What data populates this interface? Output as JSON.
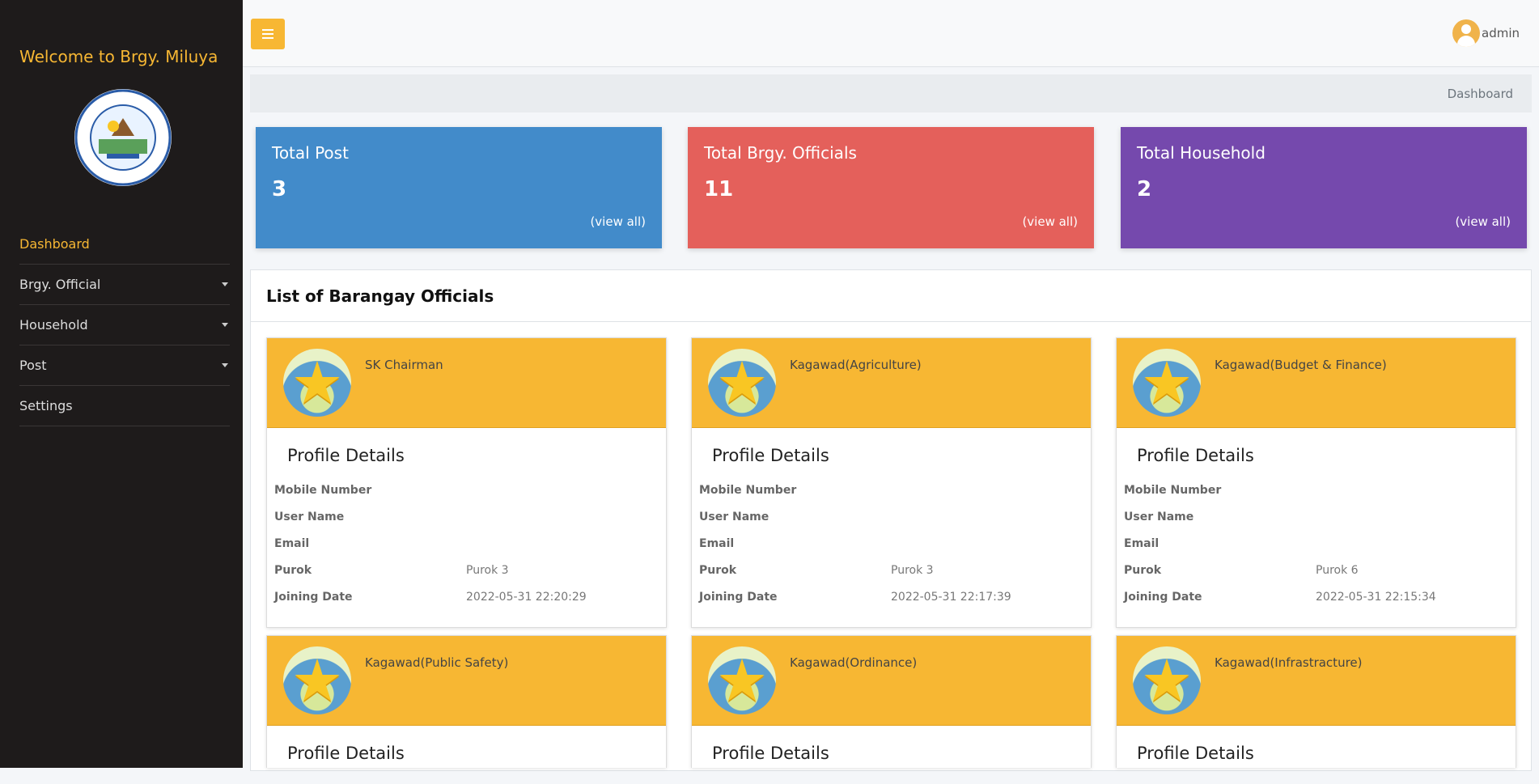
{
  "sidebar": {
    "brand": "Welcome to Brgy. Miluya",
    "logo_text_top": "BARANGAY MILUYA",
    "logo_text_bottom": "CASTILLA, SORSOGON",
    "items": [
      {
        "label": "Dashboard",
        "active": true,
        "has_caret": false
      },
      {
        "label": "Brgy. Official",
        "active": false,
        "has_caret": true
      },
      {
        "label": "Household",
        "active": false,
        "has_caret": true
      },
      {
        "label": "Post",
        "active": false,
        "has_caret": true
      },
      {
        "label": "Settings",
        "active": false,
        "has_caret": false
      }
    ]
  },
  "topbar": {
    "menu_icon": "hamburger-icon",
    "user_name": "admin",
    "user_icon": "user-avatar-icon"
  },
  "breadcrumb": {
    "current": "Dashboard"
  },
  "stats": [
    {
      "title": "Total Post",
      "value": "3",
      "link": "(view all)",
      "color": "#428bca"
    },
    {
      "title": "Total Brgy. Officials",
      "value": "11",
      "link": "(view all)",
      "color": "#e4605b"
    },
    {
      "title": "Total Household",
      "value": "2",
      "link": "(view all)",
      "color": "#7549ad"
    }
  ],
  "officials": {
    "heading": "List of Barangay Officials",
    "section_title": "Profile Details",
    "labels": {
      "mobile": "Mobile Number",
      "username": "User Name",
      "email": "Email",
      "purok": "Purok",
      "joining": "Joining Date"
    },
    "cards": [
      {
        "position": "SK Chairman",
        "mobile": "",
        "username": "",
        "email": "",
        "purok": "Purok 3",
        "joining": "2022-05-31 22:20:29"
      },
      {
        "position": "Kagawad(Agriculture)",
        "mobile": "",
        "username": "",
        "email": "",
        "purok": "Purok 3",
        "joining": "2022-05-31 22:17:39"
      },
      {
        "position": "Kagawad(Budget & Finance)",
        "mobile": "",
        "username": "",
        "email": "",
        "purok": "Purok 6",
        "joining": "2022-05-31 22:15:34"
      },
      {
        "position": "Kagawad(Public Safety)"
      },
      {
        "position": "Kagawad(Ordinance)"
      },
      {
        "position": "Kagawad(Infrastracture)"
      }
    ]
  },
  "colors": {
    "sidebar_bg": "#1e1b1b",
    "accent": "#f7b733"
  }
}
